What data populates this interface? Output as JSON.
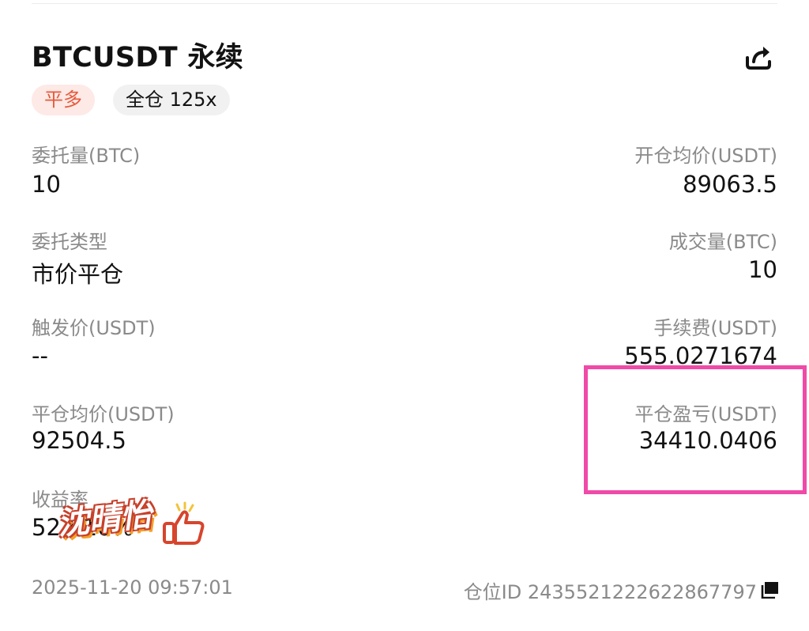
{
  "header": {
    "title": "BTCUSDT 永续",
    "share_icon": "share-icon"
  },
  "badges": {
    "side": "平多",
    "margin": "全仓 125x"
  },
  "fields": {
    "order_qty": {
      "label": "委托量(BTC)",
      "value": "10"
    },
    "open_avg_price": {
      "label": "开仓均价(USDT)",
      "value": "89063.5"
    },
    "order_type": {
      "label": "委托类型",
      "value": "市价平仓"
    },
    "filled_qty": {
      "label": "成交量(BTC)",
      "value": "10"
    },
    "trigger_price": {
      "label": "触发价(USDT)",
      "value": "--"
    },
    "fee": {
      "label": "手续费(USDT)",
      "value": "555.0271674"
    },
    "close_avg_price": {
      "label": "平仓均价(USDT)",
      "value": "92504.5"
    },
    "realized_pnl": {
      "label": "平仓盈亏(USDT)",
      "value": "34410.0406"
    },
    "yield": {
      "label": "收益率",
      "value": "522.10%"
    }
  },
  "sticker": {
    "text": "沈晴怡",
    "icon": "thumbs-up-icon"
  },
  "footer": {
    "timestamp": "2025-11-20 09:57:01",
    "position_id": "仓位ID 2435521222622867797",
    "copy_icon": "copy-icon"
  },
  "colors": {
    "side_badge_text": "#e55a3c",
    "side_badge_bg": "#fde9e6",
    "highlight_border": "#f04aa8",
    "label": "#8a8a8a",
    "value": "#121212"
  }
}
